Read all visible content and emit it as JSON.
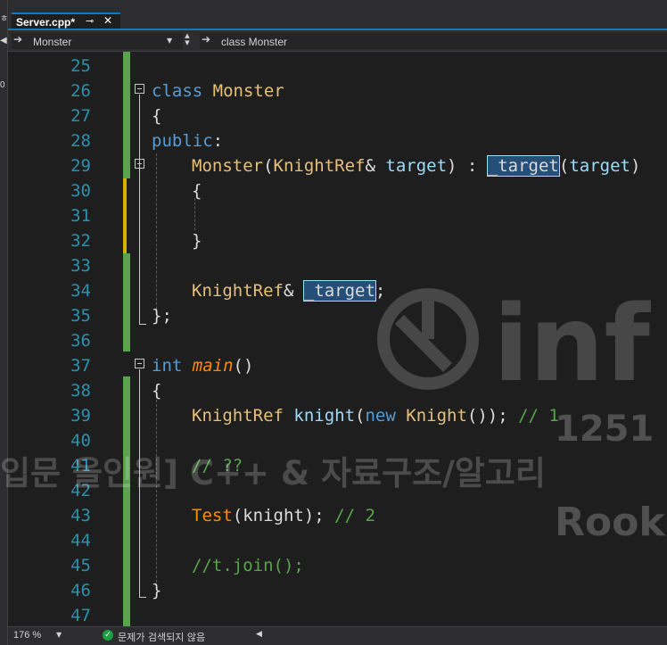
{
  "side_labels": [
    "ㅎ",
    "◀",
    "0"
  ],
  "tab": {
    "title": "Server.cpp*",
    "pin_icon": "pin-icon",
    "close_icon": "close-icon"
  },
  "nav": {
    "scope": "Monster",
    "member": "class Monster",
    "scope_icon": "arrow-right-icon",
    "member_icon": "arrow-right-icon"
  },
  "line_numbers": [
    "25",
    "26",
    "27",
    "28",
    "29",
    "30",
    "31",
    "32",
    "33",
    "34",
    "35",
    "36",
    "37",
    "38",
    "39",
    "40",
    "41",
    "42",
    "43",
    "44",
    "45",
    "46",
    "47"
  ],
  "code": {
    "l26_kw": "class",
    "l26_name": " Monster",
    "l27": "{",
    "l28_kw": "public",
    "l28_colon": ":",
    "l29_fn": "Monster",
    "l29_open": "(",
    "l29_type": "KnightRef",
    "l29_amp": "& ",
    "l29_param": "target",
    "l29_init": ") : ",
    "l29_member": "_target",
    "l29_paren": "(",
    "l29_arg": "target",
    "l29_close": ")",
    "l30": "{",
    "l32": "}",
    "l34_type": "KnightRef",
    "l34_amp": "& ",
    "l34_member": "_target",
    "l34_semi": ";",
    "l35": "};",
    "l37_kw": "int",
    "l37_fn": "main",
    "l37_paren": "()",
    "l38": "{",
    "l39_type": "KnightRef",
    "l39_var": " knight",
    "l39_open": "(",
    "l39_new": "new",
    "l39_cls": " Knight",
    "l39_rest": "()); ",
    "l39_cm": "// 1",
    "l41_cm": "// ??",
    "l43_fn": "Test",
    "l43_args": "(knight); ",
    "l43_cm": "// 2",
    "l45_cm": "//t.join();",
    "l46": "}"
  },
  "watermark": {
    "line1": "1251",
    "line2": "입문 올인원] C++ & 자료구조/알고리",
    "line3": "Rook",
    "logo": "inf le"
  },
  "status": {
    "zoom": "176 %",
    "message": "문제가 검색되지 않음",
    "ok_icon": "check-circle-icon"
  },
  "colors": {
    "accent": "#0e7ac0",
    "change_saved": "#57a64a",
    "change_unsaved": "#d9b200",
    "keyword": "#569cd6",
    "selection": "#264f78"
  }
}
